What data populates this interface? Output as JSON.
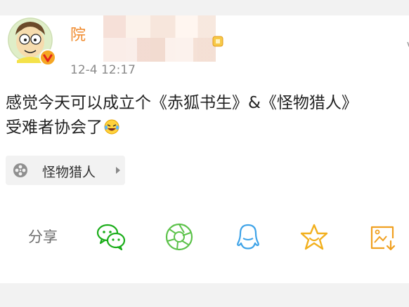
{
  "post": {
    "username": "院",
    "timestamp": "12-4 12:17",
    "content_line1": "感觉今天可以成立个《赤狐书生》&《怪物猎人》",
    "content_line2": "受难者协会了",
    "topic": "怪物猎人"
  },
  "share": {
    "label": "分享"
  },
  "colors": {
    "username": "#f08a2c",
    "wechat_green": "#1aad19",
    "moments_green": "#5cc24a",
    "qq_blue": "#3ea3e8",
    "favorite_gold": "#f2b01e",
    "save_orange": "#f0a020"
  },
  "icons": {
    "avatar": "cartoon-avatar",
    "verified": "verified-badge-icon",
    "topic": "film-reel-icon",
    "share_targets": [
      "wechat-icon",
      "moments-icon",
      "qq-icon",
      "favorite-star-icon",
      "save-image-icon"
    ]
  }
}
